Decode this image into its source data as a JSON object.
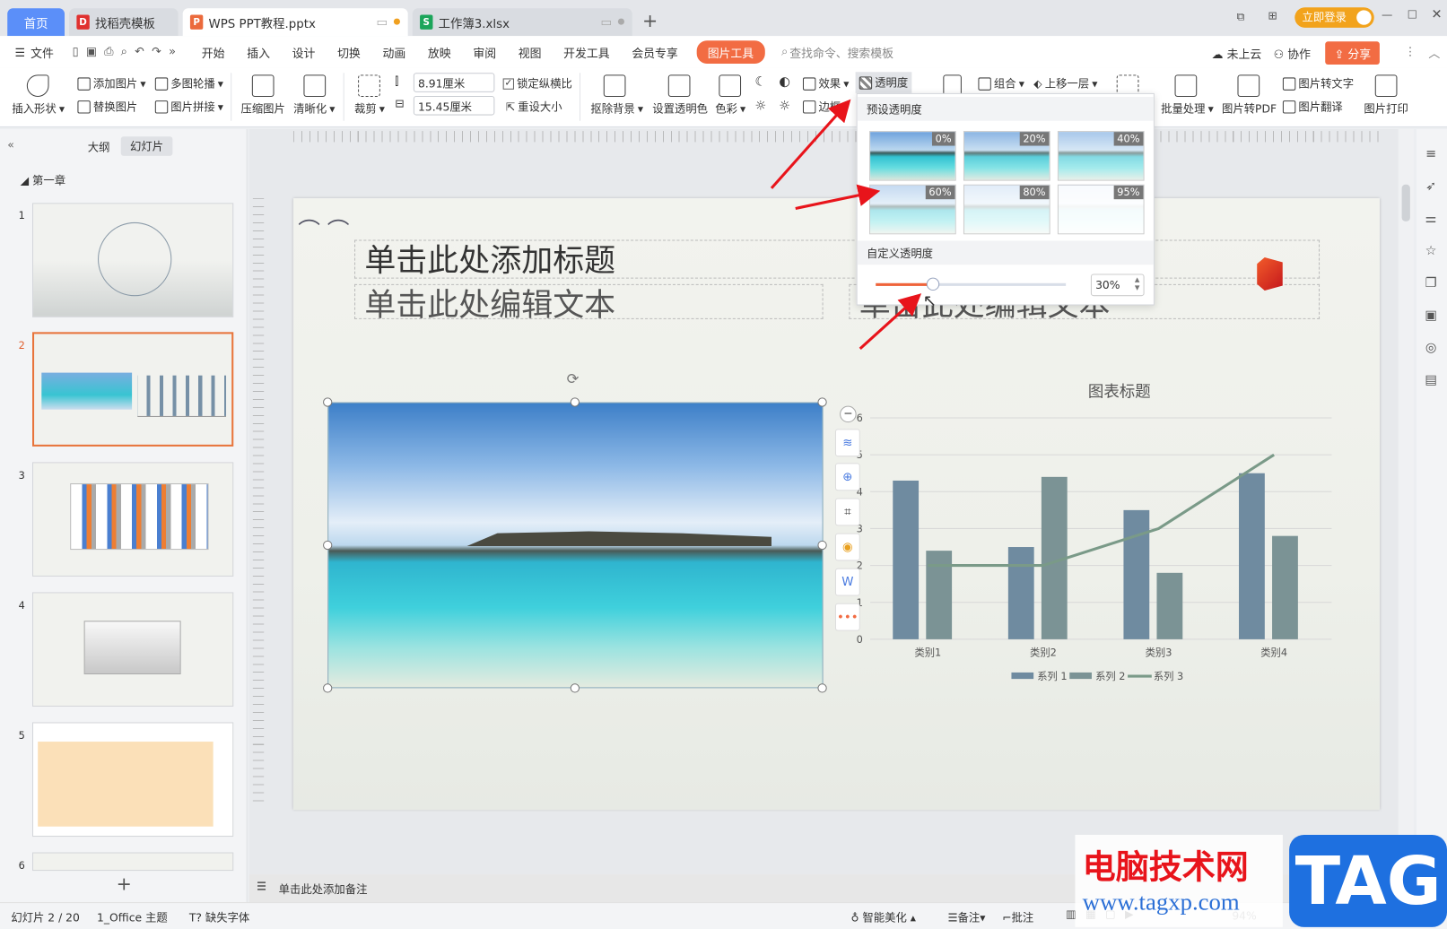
{
  "tabs": [
    {
      "label": "首页"
    },
    {
      "label": "找稻壳模板"
    },
    {
      "label": "WPS PPT教程.pptx"
    },
    {
      "label": "工作簿3.xlsx"
    }
  ],
  "topright": {
    "login": "立即登录"
  },
  "menu": {
    "file": "文件",
    "items": [
      "开始",
      "插入",
      "设计",
      "切换",
      "动画",
      "放映",
      "审阅",
      "视图",
      "开发工具",
      "会员专享"
    ],
    "active_tool": "图片工具",
    "search_placeholder": "查找命令、搜索模板",
    "cloud": "未上云",
    "collab": "协作",
    "share": "分享"
  },
  "ribbon": {
    "insert_shape": "插入形状",
    "add_picture": "添加图片",
    "multi_carousel": "多图轮播",
    "replace_picture": "替换图片",
    "picture_splice": "图片拼接",
    "compress": "压缩图片",
    "sharpen": "清晰化",
    "crop": "裁剪",
    "height": "8.91厘米",
    "width": "15.45厘米",
    "lock_ratio": "锁定纵横比",
    "reset_size": "重设大小",
    "remove_bg": "抠除背景",
    "set_transparent": "设置透明色",
    "color": "色彩",
    "effects": "效果",
    "transparency": "透明度",
    "border": "边框",
    "group": "组合",
    "bring_forward": "上移一层",
    "batch": "批量处理",
    "to_pdf": "图片转PDF",
    "to_text": "图片转文字",
    "translate": "图片翻译",
    "print": "图片打印"
  },
  "left_panel": {
    "tab_outline": "大纲",
    "tab_slides": "幻灯片",
    "chapter": "第一章",
    "slides": [
      "1",
      "2",
      "3",
      "4",
      "5",
      "6"
    ],
    "add": "+"
  },
  "slide": {
    "title": "单击此处添加标题",
    "body_left": "单击此处编辑文本",
    "body_right": "单击此处编辑文本"
  },
  "popup": {
    "preset_header": "预设透明度",
    "presets": [
      "0%",
      "20%",
      "40%",
      "60%",
      "80%",
      "95%"
    ],
    "preset_values": [
      0,
      20,
      40,
      60,
      80,
      95
    ],
    "custom_header": "自定义透明度",
    "value": "30%",
    "slider_fraction": 0.3
  },
  "chart_data": {
    "type": "bar+line",
    "title": "图表标题",
    "categories": [
      "类别1",
      "类别2",
      "类别3",
      "类别4"
    ],
    "series": [
      {
        "name": "系列 1",
        "type": "bar",
        "color": "#6f8ba0",
        "values": [
          4.3,
          2.5,
          3.5,
          4.5
        ]
      },
      {
        "name": "系列 2",
        "type": "bar",
        "color": "#7b9395",
        "values": [
          2.4,
          4.4,
          1.8,
          2.8
        ]
      },
      {
        "name": "系列 3",
        "type": "line",
        "color": "#7a9a88",
        "values": [
          2,
          2,
          3,
          5
        ]
      }
    ],
    "ylim": [
      0,
      6
    ],
    "yticks": [
      "0",
      "1",
      "2",
      "3",
      "4",
      "5",
      "6"
    ],
    "grid": true,
    "legend": "bottom"
  },
  "notes": {
    "placeholder": "单击此处添加备注"
  },
  "status": {
    "slide_info": "幻灯片 2 / 20",
    "theme": "1_Office 主题",
    "missing_font": "缺失字体",
    "beautify": "智能美化",
    "notes": "备注",
    "comment": "批注",
    "zoom": "94%"
  },
  "watermark": {
    "site": "电脑技术网",
    "url": "www.tagxp.com",
    "logo": "TAG"
  }
}
